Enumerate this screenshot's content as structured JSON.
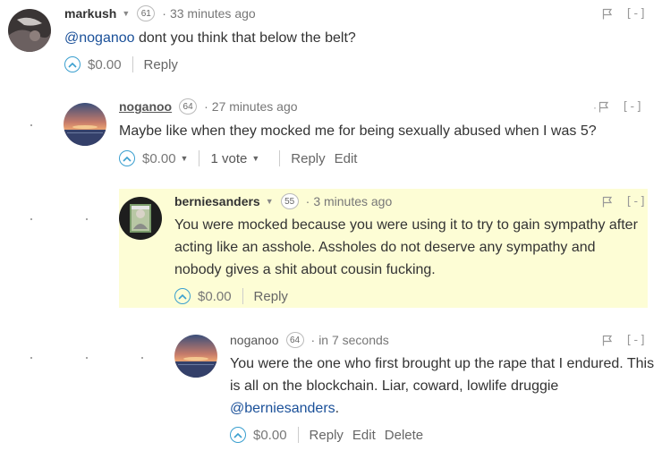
{
  "comments": [
    {
      "author": "markush",
      "reputation": "61",
      "time": "33 minutes ago",
      "body_mention": "@noganoo",
      "body": " dont you think that below the belt?",
      "payout": "$0.00",
      "reply_label": "Reply",
      "collapse_label": "[-]"
    },
    {
      "author": "noganoo",
      "reputation": "64",
      "time": "27 minutes ago",
      "body": "Maybe like when they mocked me for being sexually abused when I was 5?",
      "payout": "$0.00",
      "votes": "1 vote",
      "reply_label": "Reply",
      "edit_label": "Edit",
      "collapse_label": "[-]"
    },
    {
      "author": "berniesanders",
      "reputation": "55",
      "time": "3 minutes ago",
      "body": "You were mocked because you were using it to try to gain sympathy after acting like an asshole. Assholes do not deserve any sympathy and nobody gives a shit about cousin fucking.",
      "payout": "$0.00",
      "reply_label": "Reply",
      "collapse_label": "[-]"
    },
    {
      "author": "noganoo",
      "reputation": "64",
      "time": "in 7 seconds",
      "body": "You were the one who first brought up the rape that I endured. This is all on the blockchain. Liar, coward, lowlife druggie",
      "body_mention": "@berniesanders",
      "body_end": ".",
      "payout": "$0.00",
      "reply_label": "Reply",
      "edit_label": "Edit",
      "delete_label": "Delete",
      "collapse_label": "[-]"
    }
  ],
  "icons": {
    "flag": "flag-icon",
    "upvote": "chevron-up-circle-icon",
    "caret": "caret-down-icon"
  },
  "colors": {
    "highlight_bg": "#fdfdd5",
    "upvote_accent": "#3a9fcf",
    "mention": "#1a5099"
  }
}
